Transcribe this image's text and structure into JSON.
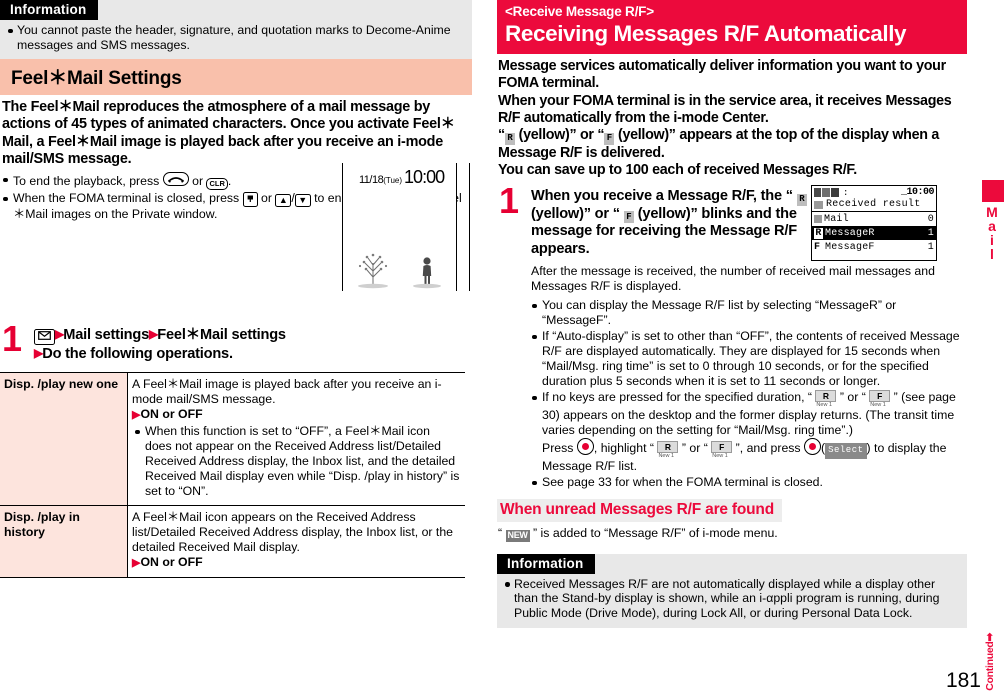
{
  "colors": {
    "brand_red": "#ec0a3c",
    "accent_red": "#e60033",
    "section_salmon": "#f9c0ab",
    "table_row_pink": "#fde4dd",
    "info_gray": "#e8e8e8",
    "subhead_gray": "#ededed"
  },
  "left": {
    "information": {
      "label": "Information",
      "bullets": [
        "You cannot paste the header, signature, and quotation marks to Decome-Anime messages and SMS messages."
      ]
    },
    "section_title": "Feel＊Mail Settings",
    "intro": "The Feel＊Mail reproduces the atmosphere of a mail message by actions of 45 types of animated characters. Once you activate Feel＊Mail, a Feel＊Mail image is played back after you receive an i-mode mail/SMS message.",
    "bullets": [
      {
        "pre": "To end the playback, press ",
        "key1": "end-key",
        "mid": " or ",
        "key2": "CLR",
        "post": "."
      },
      {
        "pre": "When the FOMA terminal is closed, press ",
        "key1": "mail-side-key",
        "mid": " or ",
        "key2": "▲",
        "key3": "▼",
        "post": " to end the playback of Feel＊Mail images on the Private window."
      }
    ],
    "standby_illustration": {
      "date": "11/18",
      "weekday": "(Tue)",
      "time": "10:00"
    },
    "step": {
      "number": "1",
      "key_icon": "mail-envelope-key",
      "line1_a": "Mail settings",
      "line1_b": "Feel＊Mail settings",
      "line2": "Do the following operations."
    },
    "table": {
      "rows": [
        {
          "name": "Disp. /play new one",
          "desc": "A Feel＊Mail image is played back after you receive an i-mode mail/SMS message.",
          "choice": "ON or OFF",
          "note": "When this function is set to “OFF”, a Feel＊Mail icon does not appear on the Received Address list/Detailed Received Address display, the Inbox list, and the detailed Received Mail display even while “Disp. /play in history” is set to “ON”."
        },
        {
          "name": "Disp. /play in history",
          "desc": "A Feel＊Mail icon appears on the Received Address list/Detailed Received Address display, the Inbox list, or the detailed Received Mail display.",
          "choice": "ON or OFF",
          "note": ""
        }
      ]
    }
  },
  "right": {
    "header": {
      "kicker": "<Receive Message R/F>",
      "title": "Receiving Messages R/F Automatically"
    },
    "intro_lines": [
      "Message services automatically deliver information you want to your FOMA terminal.",
      "When your FOMA terminal is in the service area, it receives Messages R/F automatically from the i-mode Center.",
      "“ R (yellow)” or “ F (yellow)” appears at the top of the display when a Message R/F is delivered.",
      "You can save up to 100 each of received Messages R/F."
    ],
    "intro_icon_r": "R",
    "intro_icon_f": "F",
    "step": {
      "number": "1",
      "text_a": "When you receive a Message R/F, the “ ",
      "icon_r": "R",
      "text_b": " (yellow)” or “ ",
      "icon_f": "F",
      "text_c": " (yellow)” blinks and the message for receiving the Message R/F appears."
    },
    "after_text": "After the message is received, the number of received mail messages and Messages R/F is displayed.",
    "bullets": [
      "You can display the Message R/F list by selecting “MessageR” or “MessageF”.",
      "If “Auto-display” is set to other than “OFF”, the contents of received Message R/F are displayed automatically. They are displayed for 15 seconds when “Mail/Msg. ring time” is set to 0 through 10 seconds, or for the specified duration plus 5 seconds when it is set to 11 seconds or longer.",
      "See page 33 for when the FOMA terminal is closed."
    ],
    "bullet_keys": {
      "pre": "If no keys are pressed for the specified duration, “ ",
      "mid1": " ” or “ ",
      "mid2": " ” (see page 30) appears on the desktop and the former display returns. (The transit time varies depending on the setting for “Mail/Msg. ring time”.)",
      "press_pre": "Press ",
      "press_mid": ", highlight “ ",
      "press_mid2": " ” or “ ",
      "press_mid3": " ”, and press ",
      "select_label": "Select",
      "press_post": ") to display the Message R/F list.",
      "icon_r": "R",
      "icon_f": "F",
      "icon_caption": "New 1"
    },
    "screen": {
      "time": "10:00",
      "title": "Received result",
      "rows": [
        {
          "letter": "",
          "label": "Mail",
          "count": "0",
          "selected": false
        },
        {
          "letter": "R",
          "label": "MessageR",
          "count": "1",
          "selected": true
        },
        {
          "letter": "F",
          "label": "MessageF",
          "count": "1",
          "selected": false
        }
      ]
    },
    "subhead": "When unread Messages R/F are found",
    "subhead_body_pre": "“ ",
    "subhead_chip": "NEW",
    "subhead_body_post": " ” is added to “Message R/F” of i-mode menu.",
    "information": {
      "label": "Information",
      "bullets": [
        "Received Messages R/F are not automatically displayed while a display other than the Stand-by display is shown, while an i-αppli program is running, during Public Mode (Drive Mode), during Lock All, or during Personal Data Lock."
      ]
    },
    "side_tab_label": "Mail",
    "footer": {
      "page_number": "181",
      "continued": "Continued➡"
    }
  }
}
